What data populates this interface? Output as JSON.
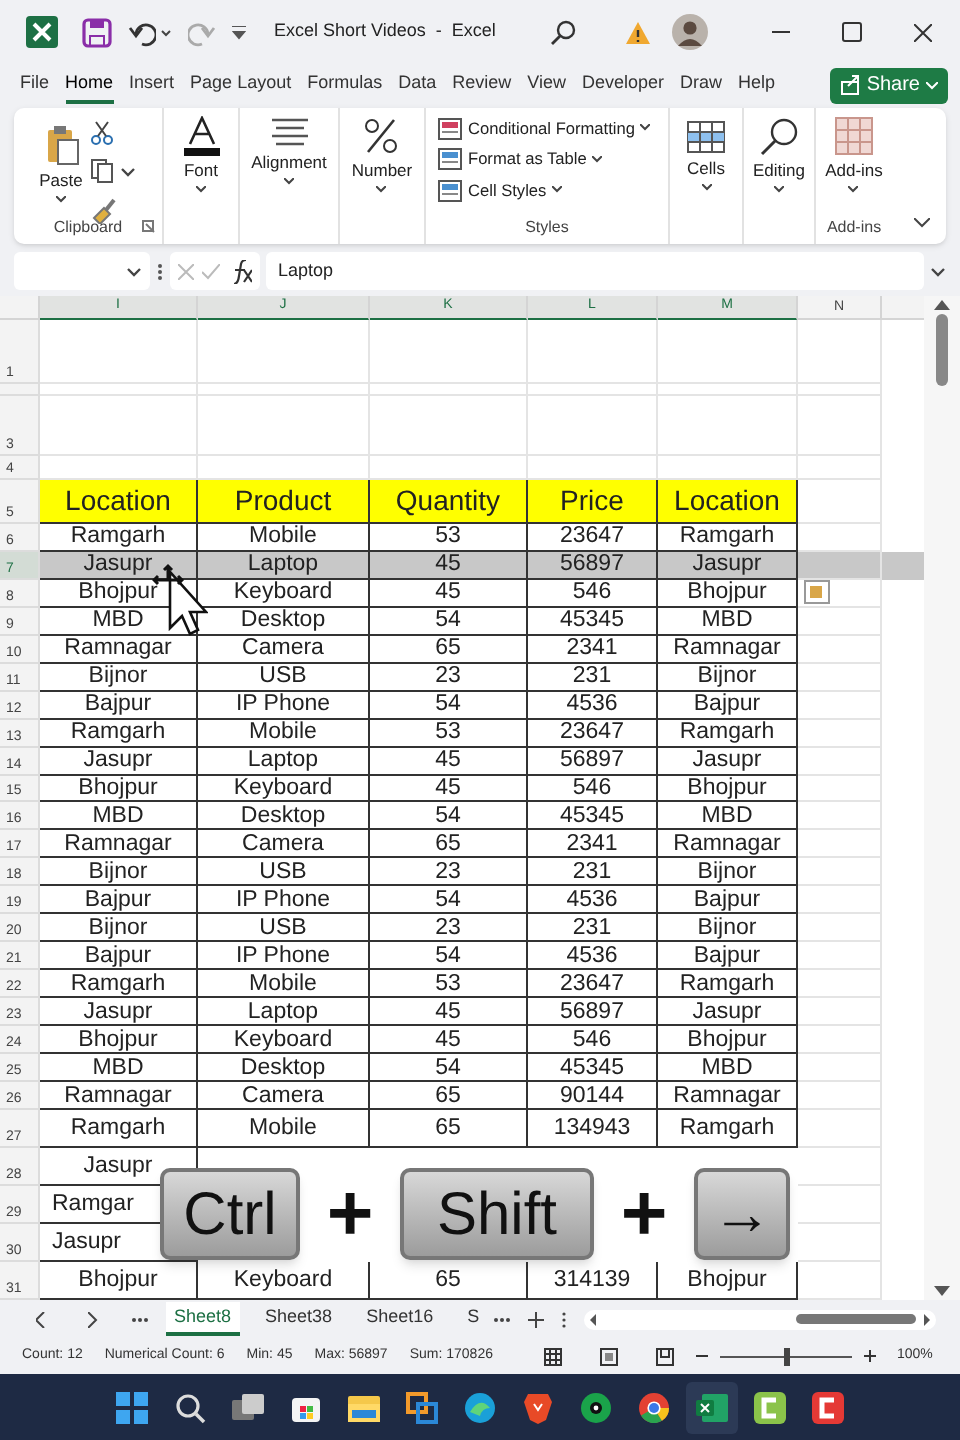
{
  "window": {
    "title": "Excel Short Videos  -  Excel"
  },
  "ribbon_tabs": [
    {
      "label": "File",
      "selected": false
    },
    {
      "label": "Home",
      "selected": true
    },
    {
      "label": "Insert",
      "selected": false
    },
    {
      "label": "Page Layout",
      "selected": false
    },
    {
      "label": "Formulas",
      "selected": false
    },
    {
      "label": "Data",
      "selected": false
    },
    {
      "label": "Review",
      "selected": false
    },
    {
      "label": "View",
      "selected": false
    },
    {
      "label": "Developer",
      "selected": false
    },
    {
      "label": "Draw",
      "selected": false
    },
    {
      "label": "Help",
      "selected": false
    }
  ],
  "share_button": "Share",
  "ribbon_groups": [
    {
      "kind": "clipboard",
      "button": "Paste",
      "label": "Clipboard"
    },
    {
      "kind": "font",
      "button": "Font"
    },
    {
      "kind": "alignment",
      "button": "Alignment"
    },
    {
      "kind": "number",
      "button": "Number"
    },
    {
      "kind": "styles",
      "items": [
        "Conditional Formatting",
        "Format as Table",
        "Cell Styles"
      ],
      "label": "Styles"
    },
    {
      "kind": "cells",
      "button": "Cells"
    },
    {
      "kind": "editing",
      "button": "Editing"
    },
    {
      "kind": "addins",
      "button": "Add-ins",
      "label": "Add-ins"
    }
  ],
  "formula_bar": {
    "value": "Laptop"
  },
  "columns": [
    {
      "label": "I",
      "selected": true
    },
    {
      "label": "J",
      "selected": true
    },
    {
      "label": "K",
      "selected": true
    },
    {
      "label": "L",
      "selected": true
    },
    {
      "label": "M",
      "selected": true
    },
    {
      "label": "N",
      "selected": false
    }
  ],
  "rows": [
    {
      "number": "1",
      "kind": "blank",
      "selected": false
    },
    {
      "kind": "gap",
      "selected": false
    },
    {
      "number": "3",
      "kind": "blank",
      "selected": false
    },
    {
      "number": "4",
      "kind": "blank",
      "selected": false
    },
    {
      "number": "5",
      "kind": "header",
      "selected": false,
      "cells": [
        "Location",
        "Product",
        "Quantity",
        "Price",
        "Location"
      ]
    },
    {
      "number": "6",
      "kind": "data",
      "selected": false,
      "cells": [
        "Ramgarh",
        "Mobile",
        "53",
        "23647",
        "Ramgarh"
      ]
    },
    {
      "number": "7",
      "kind": "data",
      "selected": true,
      "cells": [
        "Jasupr",
        "Laptop",
        "45",
        "56897",
        "Jasupr"
      ]
    },
    {
      "number": "8",
      "kind": "data",
      "selected": false,
      "cells": [
        "Bhojpur",
        "Keyboard",
        "45",
        "546",
        "Bhojpur"
      ]
    },
    {
      "number": "9",
      "kind": "data",
      "selected": false,
      "cells": [
        "MBD",
        "Desktop",
        "54",
        "45345",
        "MBD"
      ]
    },
    {
      "number": "10",
      "kind": "data",
      "selected": false,
      "cells": [
        "Ramnagar",
        "Camera",
        "65",
        "2341",
        "Ramnagar"
      ]
    },
    {
      "number": "11",
      "kind": "data",
      "selected": false,
      "cells": [
        "Bijnor",
        "USB",
        "23",
        "231",
        "Bijnor"
      ]
    },
    {
      "number": "12",
      "kind": "data",
      "selected": false,
      "cells": [
        "Bajpur",
        "IP Phone",
        "54",
        "4536",
        "Bajpur"
      ]
    },
    {
      "number": "13",
      "kind": "data",
      "selected": false,
      "cells": [
        "Ramgarh",
        "Mobile",
        "53",
        "23647",
        "Ramgarh"
      ]
    },
    {
      "number": "14",
      "kind": "data",
      "selected": false,
      "cells": [
        "Jasupr",
        "Laptop",
        "45",
        "56897",
        "Jasupr"
      ]
    },
    {
      "number": "15",
      "kind": "data",
      "selected": false,
      "cells": [
        "Bhojpur",
        "Keyboard",
        "45",
        "546",
        "Bhojpur"
      ]
    },
    {
      "number": "16",
      "kind": "data",
      "selected": false,
      "cells": [
        "MBD",
        "Desktop",
        "54",
        "45345",
        "MBD"
      ]
    },
    {
      "number": "17",
      "kind": "data",
      "selected": false,
      "cells": [
        "Ramnagar",
        "Camera",
        "65",
        "2341",
        "Ramnagar"
      ]
    },
    {
      "number": "18",
      "kind": "data",
      "selected": false,
      "cells": [
        "Bijnor",
        "USB",
        "23",
        "231",
        "Bijnor"
      ]
    },
    {
      "number": "19",
      "kind": "data",
      "selected": false,
      "cells": [
        "Bajpur",
        "IP Phone",
        "54",
        "4536",
        "Bajpur"
      ]
    },
    {
      "number": "20",
      "kind": "data",
      "selected": false,
      "cells": [
        "Bijnor",
        "USB",
        "23",
        "231",
        "Bijnor"
      ]
    },
    {
      "number": "21",
      "kind": "data",
      "selected": false,
      "cells": [
        "Bajpur",
        "IP Phone",
        "54",
        "4536",
        "Bajpur"
      ]
    },
    {
      "number": "22",
      "kind": "data",
      "selected": false,
      "cells": [
        "Ramgarh",
        "Mobile",
        "53",
        "23647",
        "Ramgarh"
      ]
    },
    {
      "number": "23",
      "kind": "data",
      "selected": false,
      "cells": [
        "Jasupr",
        "Laptop",
        "45",
        "56897",
        "Jasupr"
      ]
    },
    {
      "number": "24",
      "kind": "data",
      "selected": false,
      "cells": [
        "Bhojpur",
        "Keyboard",
        "45",
        "546",
        "Bhojpur"
      ]
    },
    {
      "number": "25",
      "kind": "data",
      "selected": false,
      "cells": [
        "MBD",
        "Desktop",
        "54",
        "45345",
        "MBD"
      ]
    },
    {
      "number": "26",
      "kind": "data",
      "selected": false,
      "cells": [
        "Ramnagar",
        "Camera",
        "65",
        "90144",
        "Ramnagar"
      ]
    },
    {
      "number": "27",
      "kind": "tall",
      "selected": false,
      "cells": [
        "Ramgarh",
        "Mobile",
        "65",
        "134943",
        "Ramgarh"
      ]
    },
    {
      "number": "28",
      "kind": "tall",
      "selected": false,
      "cells": [
        "Jasupr",
        null,
        null,
        null,
        null
      ]
    },
    {
      "number": "29",
      "kind": "tall",
      "selected": false,
      "cells": [
        "Ramgar",
        null,
        null,
        null,
        null
      ]
    },
    {
      "number": "30",
      "kind": "tall",
      "selected": false,
      "cells": [
        "Jasupr",
        null,
        null,
        null,
        null
      ]
    },
    {
      "number": "31",
      "kind": "tall",
      "selected": false,
      "cells": [
        "Bhojpur",
        "Keyboard",
        "65",
        "314139",
        "Bhojpur"
      ]
    }
  ],
  "shortcut": [
    {
      "kind": "key",
      "label": "Ctrl"
    },
    {
      "kind": "plus",
      "label": "+"
    },
    {
      "kind": "key",
      "label": "Shift"
    },
    {
      "kind": "plus",
      "label": "+"
    },
    {
      "kind": "key",
      "label": "→"
    }
  ],
  "sheet_tabs": [
    {
      "label": "Sheet8",
      "selected": true
    },
    {
      "label": "Sheet38",
      "selected": false
    },
    {
      "label": "Sheet16",
      "selected": false
    },
    {
      "label": "S",
      "selected": false
    }
  ],
  "status_bar": [
    "Count: 12",
    "Numerical Count: 6",
    "Min: 45",
    "Max: 56897",
    "Sum: 170826"
  ],
  "zoom": {
    "level": 0.5,
    "reading": "100%"
  }
}
